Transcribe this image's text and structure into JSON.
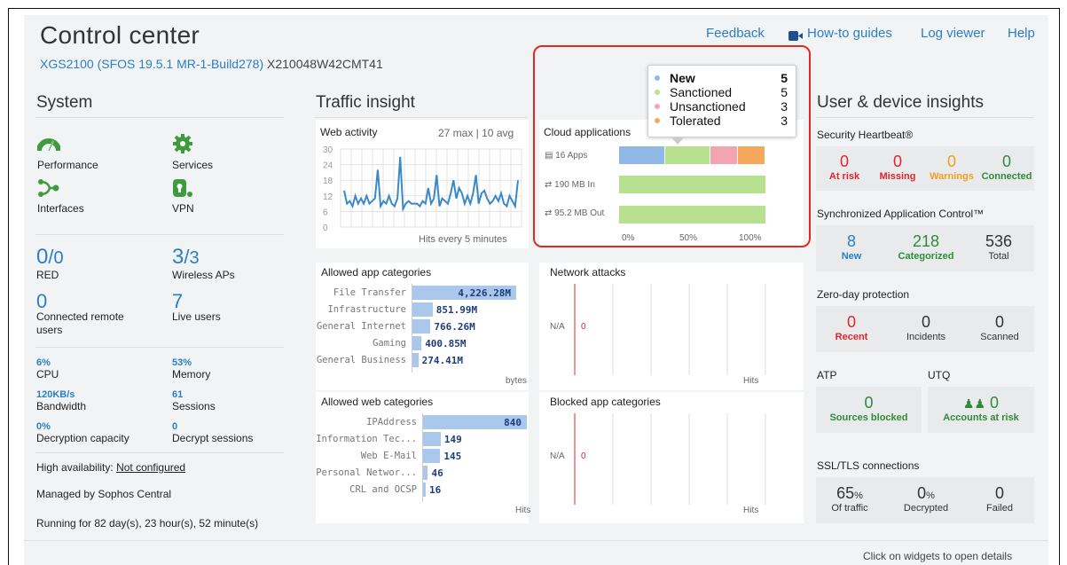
{
  "header": {
    "title": "Control center",
    "device": "XGS2100 (SFOS 19.5.1 MR-1-Build278)",
    "serial": "X210048W42CMT41",
    "links": [
      "Feedback",
      "How-to guides",
      "Log viewer",
      "Help"
    ]
  },
  "system": {
    "title": "System",
    "icons": [
      {
        "label": "Performance",
        "icon": "gauge-icon"
      },
      {
        "label": "Services",
        "icon": "gear-icon"
      },
      {
        "label": "Interfaces",
        "icon": "interfaces-icon"
      },
      {
        "label": "VPN",
        "icon": "vpn-lock-icon"
      }
    ],
    "red": {
      "value": "0",
      "total": "0",
      "label": "RED"
    },
    "aps": {
      "value": "3",
      "total": "3",
      "label": "Wireless APs"
    },
    "remote": {
      "value": "0",
      "label": "Connected remote users"
    },
    "live": {
      "value": "7",
      "label": "Live users"
    },
    "stats": [
      {
        "value": "6%",
        "label": "CPU"
      },
      {
        "value": "53%",
        "label": "Memory"
      },
      {
        "value": "120KB/s",
        "label": "Bandwidth"
      },
      {
        "value": "61",
        "label": "Sessions"
      },
      {
        "value": "0%",
        "label": "Decryption capacity"
      },
      {
        "value": "0",
        "label": "Decrypt sessions"
      }
    ],
    "ha_label": "High availability:",
    "ha_value": "Not configured",
    "managed": "Managed by Sophos Central",
    "running": "Running for 82 day(s), 23 hour(s), 52 minute(s)"
  },
  "traffic": {
    "title": "Traffic insight",
    "web_activity": {
      "title": "Web activity",
      "summary": "27 max | 10 avg",
      "footer": "Hits every 5 minutes",
      "ticks": [
        "30",
        "24",
        "18",
        "12",
        "6",
        "0"
      ],
      "values": [
        14,
        9,
        10,
        8,
        12,
        9,
        11,
        9,
        12,
        9,
        10,
        11,
        22,
        8,
        10,
        9,
        12,
        9,
        8,
        11,
        27,
        7,
        9,
        10,
        9,
        9,
        9,
        8,
        10,
        9,
        15,
        9,
        11,
        20,
        8,
        11,
        10,
        9,
        13,
        18,
        11,
        15,
        13,
        9,
        12,
        9,
        13,
        20,
        9,
        13,
        14,
        11,
        9,
        10,
        12,
        10,
        13,
        9,
        8,
        12,
        10,
        8,
        18
      ]
    },
    "cloud": {
      "title": "Cloud applications",
      "apps": "16 Apps",
      "in": "190 MB In",
      "out": "95.2 MB Out",
      "axis": [
        "0%",
        "50%",
        "100%"
      ],
      "legend": [
        {
          "label": "New",
          "value": "5",
          "color": "#8fb8e4"
        },
        {
          "label": "Sanctioned",
          "value": "5",
          "color": "#b7e08f"
        },
        {
          "label": "Unsanctioned",
          "value": "3",
          "color": "#f2a4b0"
        },
        {
          "label": "Tolerated",
          "value": "3",
          "color": "#f5a85c"
        }
      ]
    },
    "app_categories": {
      "title": "Allowed app categories",
      "unit": "bytes",
      "items": [
        {
          "name": "File Transfer",
          "value": "4,226.28M",
          "num": 4226.28
        },
        {
          "name": "Infrastructure",
          "value": "851.99M",
          "num": 851.99
        },
        {
          "name": "General Internet",
          "value": "766.26M",
          "num": 766.26
        },
        {
          "name": "Gaming",
          "value": "400.85M",
          "num": 400.85
        },
        {
          "name": "General Business",
          "value": "274.41M",
          "num": 274.41
        }
      ]
    },
    "network_attacks": {
      "title": "Network attacks",
      "na": "N/A",
      "value": "0",
      "unit": "Hits"
    },
    "web_categories": {
      "title": "Allowed web categories",
      "unit": "Hits",
      "items": [
        {
          "name": "IPAddress",
          "value": "840",
          "num": 840
        },
        {
          "name": "Information Tec...",
          "value": "149",
          "num": 149
        },
        {
          "name": "Web E-Mail",
          "value": "145",
          "num": 145
        },
        {
          "name": "Personal Networ...",
          "value": "46",
          "num": 46
        },
        {
          "name": "CRL and OCSP",
          "value": "16",
          "num": 16
        }
      ]
    },
    "blocked_apps": {
      "title": "Blocked app categories",
      "na": "N/A",
      "value": "0",
      "unit": "Hits"
    }
  },
  "user": {
    "title": "User & device insights",
    "heartbeat": {
      "title": "Security Heartbeat®",
      "items": [
        {
          "value": "0",
          "label": "At risk",
          "color": "#e0262b"
        },
        {
          "value": "0",
          "label": "Missing",
          "color": "#e0262b"
        },
        {
          "value": "0",
          "label": "Warnings",
          "color": "#f0a020"
        },
        {
          "value": "0",
          "label": "Connected",
          "color": "#2e8b3a"
        }
      ]
    },
    "sac": {
      "title": "Synchronized Application Control™",
      "items": [
        {
          "value": "8",
          "label": "New",
          "color": "#2a7fc4"
        },
        {
          "value": "218",
          "label": "Categorized",
          "color": "#2e8b3a"
        },
        {
          "value": "536",
          "label": "Total",
          "color": "#333"
        }
      ]
    },
    "zeroday": {
      "title": "Zero-day protection",
      "items": [
        {
          "value": "0",
          "label": "Recent",
          "color": "#e0262b"
        },
        {
          "value": "0",
          "label": "Incidents",
          "color": "#333"
        },
        {
          "value": "0",
          "label": "Scanned",
          "color": "#333"
        }
      ]
    },
    "atp": {
      "title": "ATP",
      "value": "0",
      "label": "Sources blocked"
    },
    "utq": {
      "title": "UTQ",
      "value": "0",
      "label": "Accounts at risk"
    },
    "ssl": {
      "title": "SSL/TLS connections",
      "items": [
        {
          "value": "65",
          "unit": "%",
          "label": "Of traffic"
        },
        {
          "value": "0",
          "unit": "%",
          "label": "Decrypted"
        },
        {
          "value": "0",
          "unit": "",
          "label": "Failed"
        }
      ]
    }
  },
  "footer": "Click on widgets to open details"
}
